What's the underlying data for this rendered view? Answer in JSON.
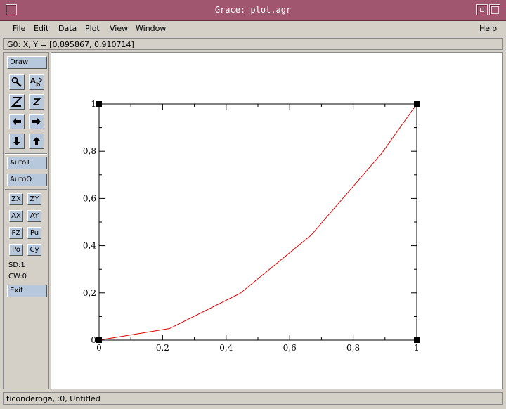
{
  "window": {
    "title": "Grace: plot.agr"
  },
  "menu": [
    {
      "label": "File",
      "key": "F",
      "rest": "ile"
    },
    {
      "label": "Edit",
      "key": "E",
      "rest": "dit"
    },
    {
      "label": "Data",
      "key": "D",
      "rest": "ata"
    },
    {
      "label": "Plot",
      "key": "P",
      "rest": "lot"
    },
    {
      "label": "View",
      "key": "V",
      "rest": "iew"
    },
    {
      "label": "Window",
      "key": "W",
      "rest": "indow"
    }
  ],
  "help": {
    "label": "Help",
    "key": "H",
    "rest": "elp"
  },
  "coord_readout": "G0: X, Y = [0,895867, 0,910714]",
  "toolbar": {
    "draw": "Draw",
    "icons": [
      "zoom-icon",
      "text-icon",
      "zoom-in-icon",
      "zoom-out-icon",
      "arrow-left-icon",
      "arrow-right-icon",
      "arrow-down-icon",
      "arrow-up-icon"
    ],
    "autot": "AutoT",
    "autoo": "AutoO",
    "small_buttons": [
      "ZX",
      "ZY",
      "AX",
      "AY",
      "PZ",
      "Pu",
      "Po",
      "Cy"
    ],
    "sd": "SD:1",
    "cw": "CW:0",
    "exit": "Exit"
  },
  "status": "ticonderoga, :0, Untitled",
  "colors": {
    "titlebar": "#a0566e",
    "button": "#b8c8dc",
    "line": "#e00000"
  },
  "chart_data": {
    "type": "line",
    "title": "",
    "xlabel": "",
    "ylabel": "",
    "xlim": [
      0,
      1
    ],
    "ylim": [
      0,
      1
    ],
    "xticks": [
      "0",
      "0,2",
      "0,4",
      "0,6",
      "0,8",
      "1"
    ],
    "yticks": [
      "0",
      "0,2",
      "0,4",
      "0,6",
      "0,8",
      "1"
    ],
    "series": [
      {
        "x": [
          0,
          0.222,
          0.444,
          0.667,
          0.889,
          1
        ],
        "y": [
          0,
          0.049,
          0.198,
          0.444,
          0.79,
          1
        ]
      }
    ]
  }
}
